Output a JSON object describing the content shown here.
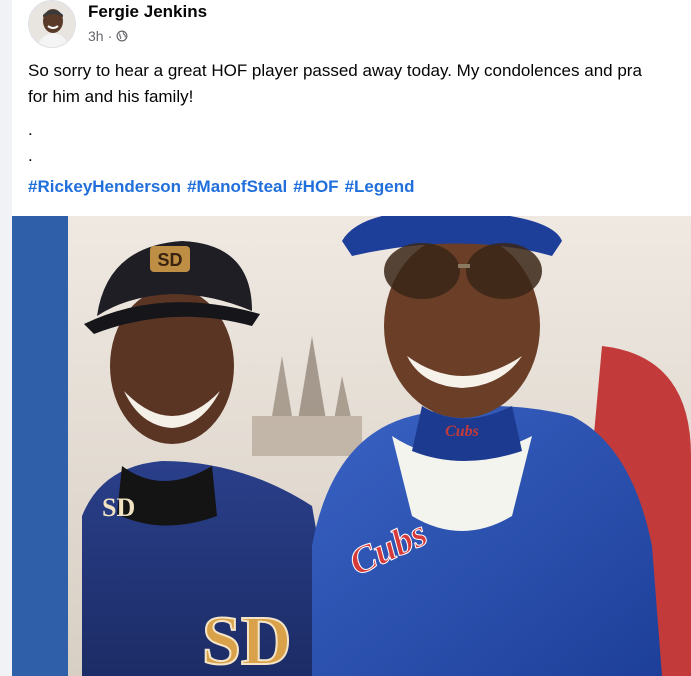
{
  "post": {
    "author": "Fergie Jenkins",
    "time": "3h",
    "separator": "·",
    "audience_icon": "globe-icon",
    "text_line1": "So sorry to hear a great HOF player passed away today.  My condolences and pra",
    "text_line2": "for him and his family!",
    "dot1": ".",
    "dot2": ".",
    "hashtags": [
      "#RickeyHenderson",
      "#ManofSteal",
      "#HOF",
      "#Legend"
    ]
  },
  "photo": {
    "left_cap_logo": "SD",
    "left_collar_logo": "SD",
    "left_chest_logo": "SD",
    "right_collar_text": "Cubs",
    "right_chest_text": "Cubs"
  },
  "colors": {
    "link": "#216fdb",
    "text": "#050505",
    "meta": "#65676b",
    "photo_border": "#2e5fa8"
  }
}
